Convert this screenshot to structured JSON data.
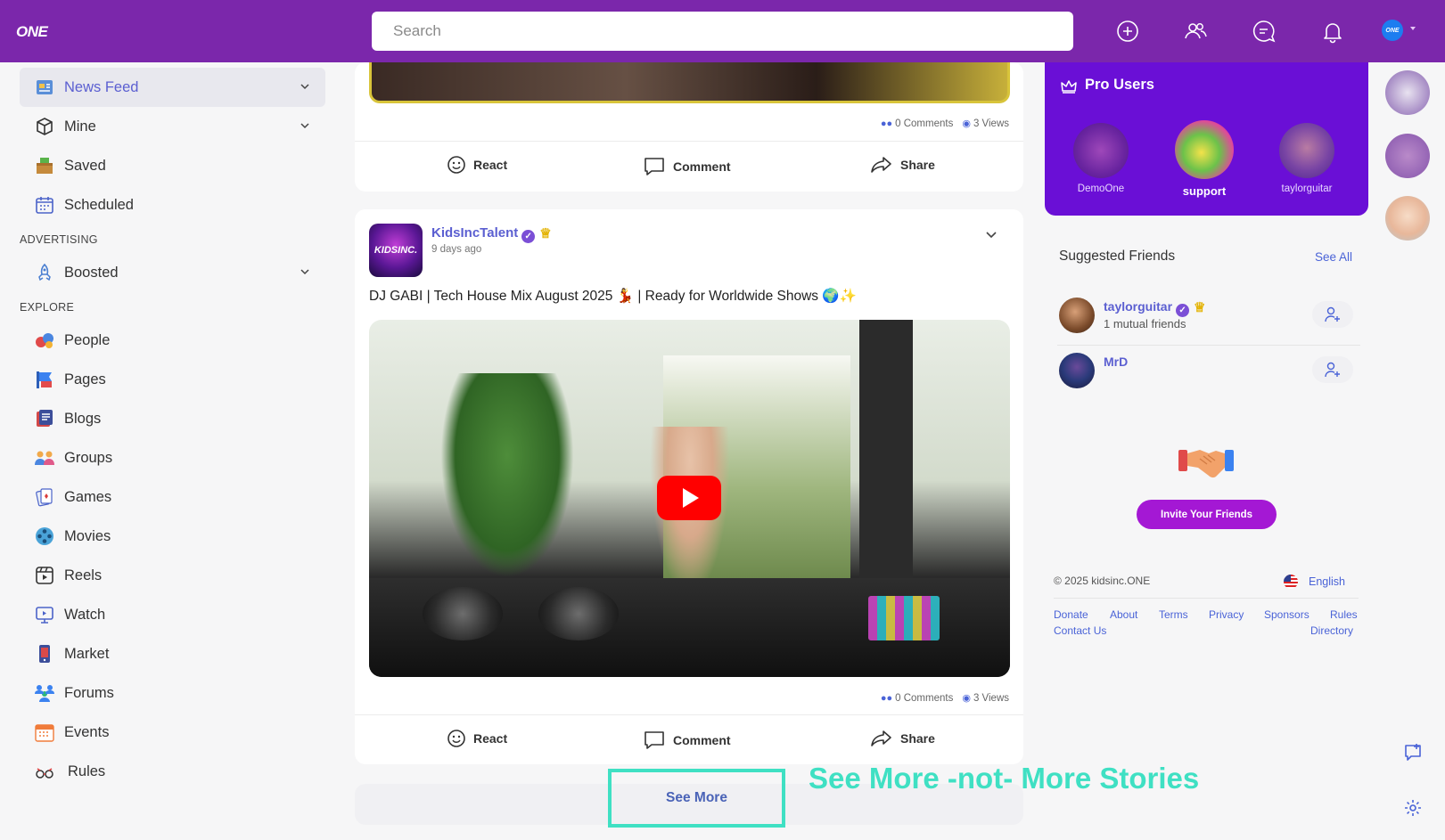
{
  "header": {
    "logo": "ONE",
    "search_placeholder": "Search",
    "icons": [
      "add-circle-icon",
      "friends-icon",
      "chat-icon",
      "bell-icon"
    ],
    "avatar_text": "ONE"
  },
  "sidebar": {
    "main_items": [
      {
        "label": "News Feed",
        "icon": "newspaper-icon",
        "active": true,
        "has_chevron": true
      },
      {
        "label": "Mine",
        "icon": "cube-icon",
        "has_chevron": true
      },
      {
        "label": "Saved",
        "icon": "saved-box-icon"
      },
      {
        "label": "Scheduled",
        "icon": "calendar-icon"
      }
    ],
    "advertising_title": "ADVERTISING",
    "advertising_items": [
      {
        "label": "Boosted",
        "icon": "rocket-icon",
        "has_chevron": true
      }
    ],
    "explore_title": "EXPLORE",
    "explore_items": [
      {
        "label": "People",
        "icon": "people-icon"
      },
      {
        "label": "Pages",
        "icon": "flag-icon"
      },
      {
        "label": "Blogs",
        "icon": "blog-icon"
      },
      {
        "label": "Groups",
        "icon": "groups-icon"
      },
      {
        "label": "Games",
        "icon": "cards-icon"
      },
      {
        "label": "Movies",
        "icon": "film-reel-icon"
      },
      {
        "label": "Reels",
        "icon": "reels-icon"
      },
      {
        "label": "Watch",
        "icon": "monitor-play-icon"
      },
      {
        "label": "Market",
        "icon": "phone-shop-icon"
      },
      {
        "label": "Forums",
        "icon": "forums-icon"
      },
      {
        "label": "Events",
        "icon": "calendar-event-icon"
      },
      {
        "label": "Rules",
        "icon": "rules-icon"
      }
    ]
  },
  "feed": {
    "first_post": {
      "comments": "0 Comments",
      "views": "3 Views"
    },
    "actions": {
      "react": "React",
      "comment": "Comment",
      "share": "Share"
    },
    "second_post": {
      "author": "KidsIncTalent",
      "avatar_text": "KIDSINC.",
      "time": "9 days ago",
      "text": "DJ GABI | Tech House Mix August 2025 💃 | Ready for Worldwide Shows 🌍✨",
      "comments": "0 Comments",
      "views": "3 Views"
    },
    "see_more": "See More",
    "annotation": "See More -not- More Stories"
  },
  "pro_users": {
    "title": "Pro Users",
    "users": [
      {
        "name": "DemoOne"
      },
      {
        "name": "support",
        "highlighted": true
      },
      {
        "name": "taylorguitar"
      }
    ]
  },
  "suggested": {
    "title": "Suggested Friends",
    "see_all": "See All",
    "friends": [
      {
        "name": "taylorguitar",
        "mutual": "1 mutual friends"
      },
      {
        "name": "MrD",
        "mutual": ""
      }
    ]
  },
  "invite": {
    "label": "Invite Your Friends"
  },
  "footer": {
    "copyright": "© 2025 kidsinc.ONE",
    "language": "English",
    "links": [
      "Donate",
      "About",
      "Terms",
      "Privacy",
      "Sponsors",
      "Rules",
      "Contact Us",
      "Directory"
    ]
  },
  "colors": {
    "header": "#7b27ab",
    "pro_panel": "#6a0fd6",
    "accent_link": "#4a63d7",
    "invite_button": "#a418d4",
    "annotation": "#3fe0c3"
  }
}
